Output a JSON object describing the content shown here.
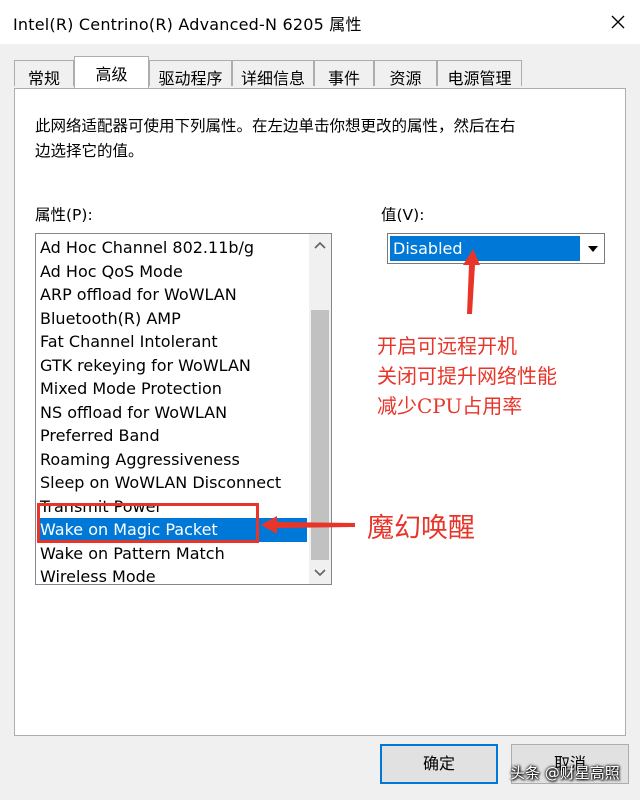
{
  "window": {
    "title": "Intel(R) Centrino(R) Advanced-N 6205 属性",
    "close_icon": "close-icon"
  },
  "tabs": [
    {
      "label": "常规",
      "active": false
    },
    {
      "label": "高级",
      "active": true
    },
    {
      "label": "驱动程序",
      "active": false
    },
    {
      "label": "详细信息",
      "active": false
    },
    {
      "label": "事件",
      "active": false
    },
    {
      "label": "资源",
      "active": false
    },
    {
      "label": "电源管理",
      "active": false
    }
  ],
  "advanced": {
    "description_line1": "此网络适配器可使用下列属性。在左边单击你想更改的属性，然后在右",
    "description_line2": "边选择它的值。",
    "property_label": "属性(P):",
    "value_label": "值(V):",
    "properties": [
      "Ad Hoc Channel 802.11b/g",
      "Ad Hoc QoS Mode",
      "ARP offload for WoWLAN",
      "Bluetooth(R) AMP",
      "Fat Channel Intolerant",
      "GTK rekeying for WoWLAN",
      "Mixed Mode Protection",
      "NS offload for WoWLAN",
      "Preferred Band",
      "Roaming Aggressiveness",
      "Sleep on WoWLAN Disconnect",
      "Transmit Power",
      "Wake on Magic Packet",
      "Wake on Pattern Match",
      "Wireless Mode"
    ],
    "selected_property": "Wake on Magic Packet",
    "value_selected": "Disabled"
  },
  "annotations": {
    "value_note_line1": "开启可远程开机",
    "value_note_line2": "关闭可提升网络性能",
    "value_note_line3": "减少CPU占用率",
    "magic_packet_note": "魔幻唤醒",
    "color": "#e8352a"
  },
  "buttons": {
    "ok": "确定",
    "cancel": "取消"
  },
  "watermark": "头条 @财星高照",
  "colors": {
    "selection": "#0078d7",
    "window_bg": "#f0f0f0"
  }
}
